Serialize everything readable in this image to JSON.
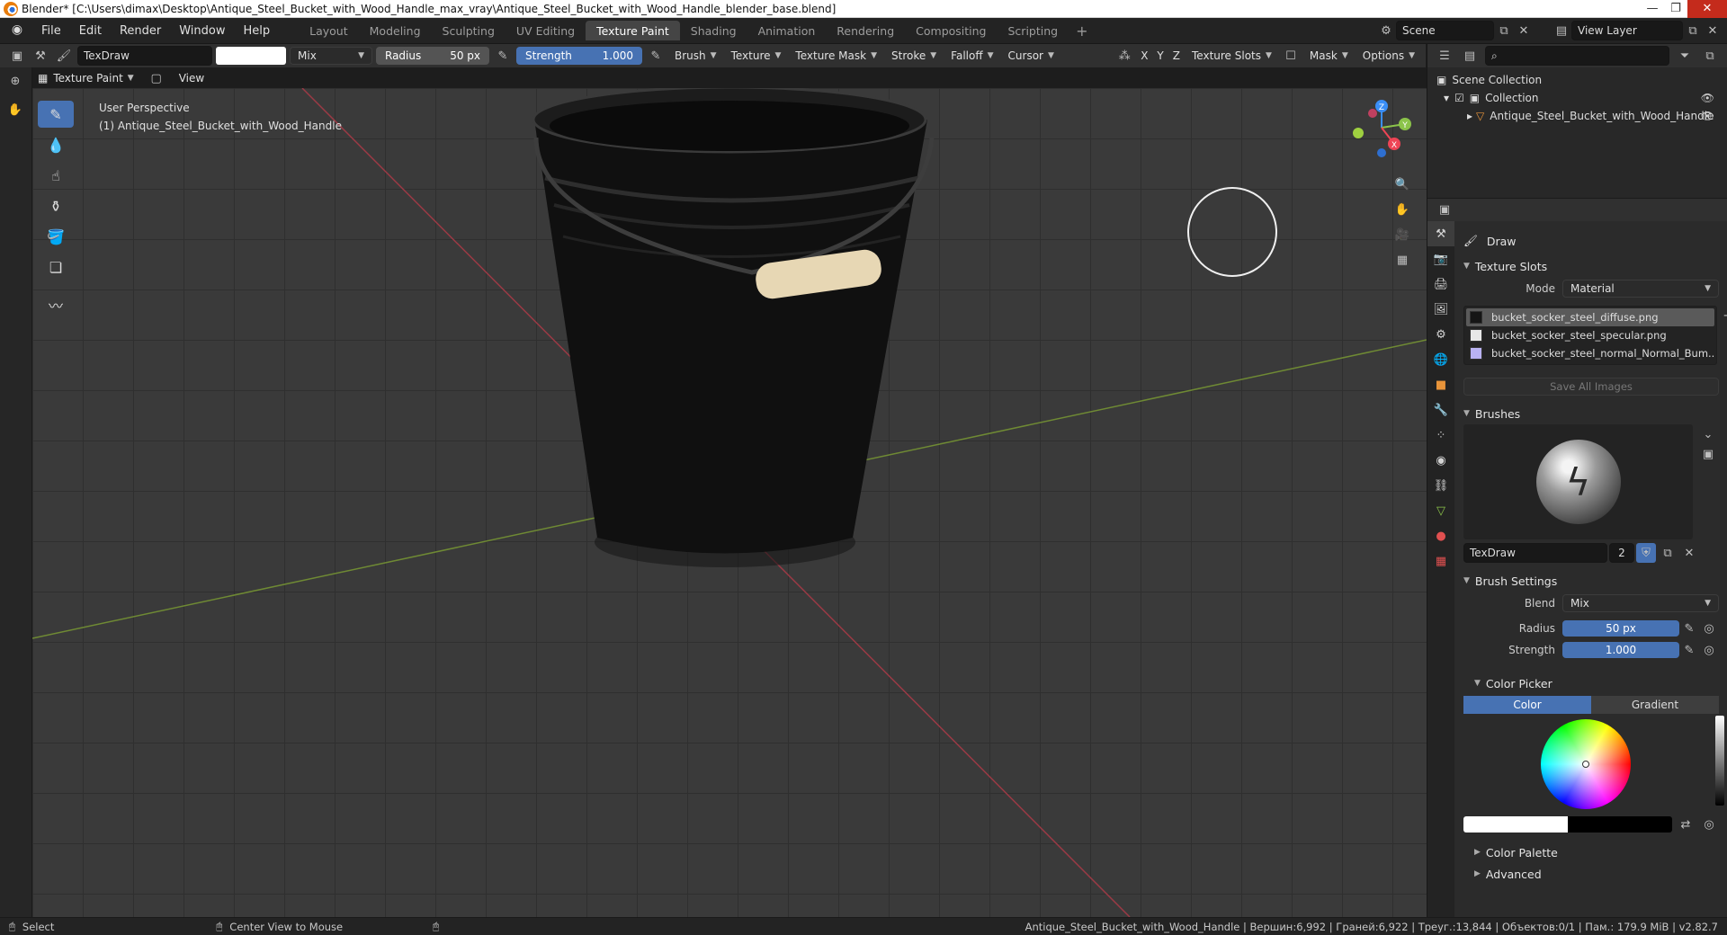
{
  "titlebar": {
    "title": "Blender* [C:\\Users\\dimax\\Desktop\\Antique_Steel_Bucket_with_Wood_Handle_max_vray\\Antique_Steel_Bucket_with_Wood_Handle_blender_base.blend]",
    "minimize": "—",
    "maximize": "❐",
    "close": "✕"
  },
  "menu": {
    "items": [
      "File",
      "Edit",
      "Render",
      "Window",
      "Help"
    ],
    "workspaces": [
      "Layout",
      "Modeling",
      "Sculpting",
      "UV Editing",
      "Texture Paint",
      "Shading",
      "Animation",
      "Rendering",
      "Compositing",
      "Scripting"
    ],
    "active_workspace": "Texture Paint",
    "add_tab": "+",
    "scene": "Scene",
    "view_layer": "View Layer"
  },
  "toolheader": {
    "brush_name": "TexDraw",
    "blend": "Mix",
    "radius_label": "Radius",
    "radius_value": "50 px",
    "strength_label": "Strength",
    "strength_value": "1.000",
    "dropdowns": [
      "Brush",
      "Texture",
      "Texture Mask",
      "Stroke",
      "Falloff",
      "Cursor"
    ],
    "axes": [
      "X",
      "Y",
      "Z"
    ],
    "texture_slots": "Texture Slots",
    "mask": "Mask",
    "options": "Options",
    "brush_color": "#ffffff"
  },
  "modeheader": {
    "mode": "Texture Paint",
    "view": "View"
  },
  "viewport": {
    "perspective": "User Perspective",
    "object_label": "(1) Antique_Steel_Bucket_with_Wood_Handle",
    "axis_x": "X",
    "axis_y": "Y",
    "axis_z": "Z"
  },
  "outliner": {
    "scene_collection": "Scene Collection",
    "collection": "Collection",
    "object": "Antique_Steel_Bucket_with_Wood_Handle"
  },
  "properties": {
    "tool_name": "Draw",
    "texture_slots_title": "Texture Slots",
    "mode_label": "Mode",
    "mode_value": "Material",
    "slots": [
      {
        "name": "bucket_socker_steel_diffuse.png",
        "color": "#151515"
      },
      {
        "name": "bucket_socker_steel_specular.png",
        "color": "#e8e8e8"
      },
      {
        "name": "bucket_socker_steel_normal_Normal_Bum..",
        "color": "#b9b2f2"
      }
    ],
    "save_all": "Save All Images",
    "brushes_title": "Brushes",
    "brush_name": "TexDraw",
    "brush_users": "2",
    "brush_settings_title": "Brush Settings",
    "blend_label": "Blend",
    "blend_value": "Mix",
    "radius_label": "Radius",
    "radius_value": "50 px",
    "strength_label": "Strength",
    "strength_value": "1.000",
    "color_picker_title": "Color Picker",
    "color_tab": "Color",
    "gradient_tab": "Gradient",
    "color_palette_title": "Color Palette",
    "advanced_title": "Advanced"
  },
  "statusbar": {
    "select": "Select",
    "center_view": "Center View to Mouse",
    "stats": "Antique_Steel_Bucket_with_Wood_Handle | Вершин:6,992 | Граней:6,922 | Треуг.:13,844 | Объектов:0/1 | Пам.: 179.9 MiB | v2.82.7"
  },
  "colors": {
    "accent": "#4772b3",
    "axis_x": "#ee4455",
    "axis_y": "#8bc34a",
    "axis_z": "#3a8ef6"
  }
}
